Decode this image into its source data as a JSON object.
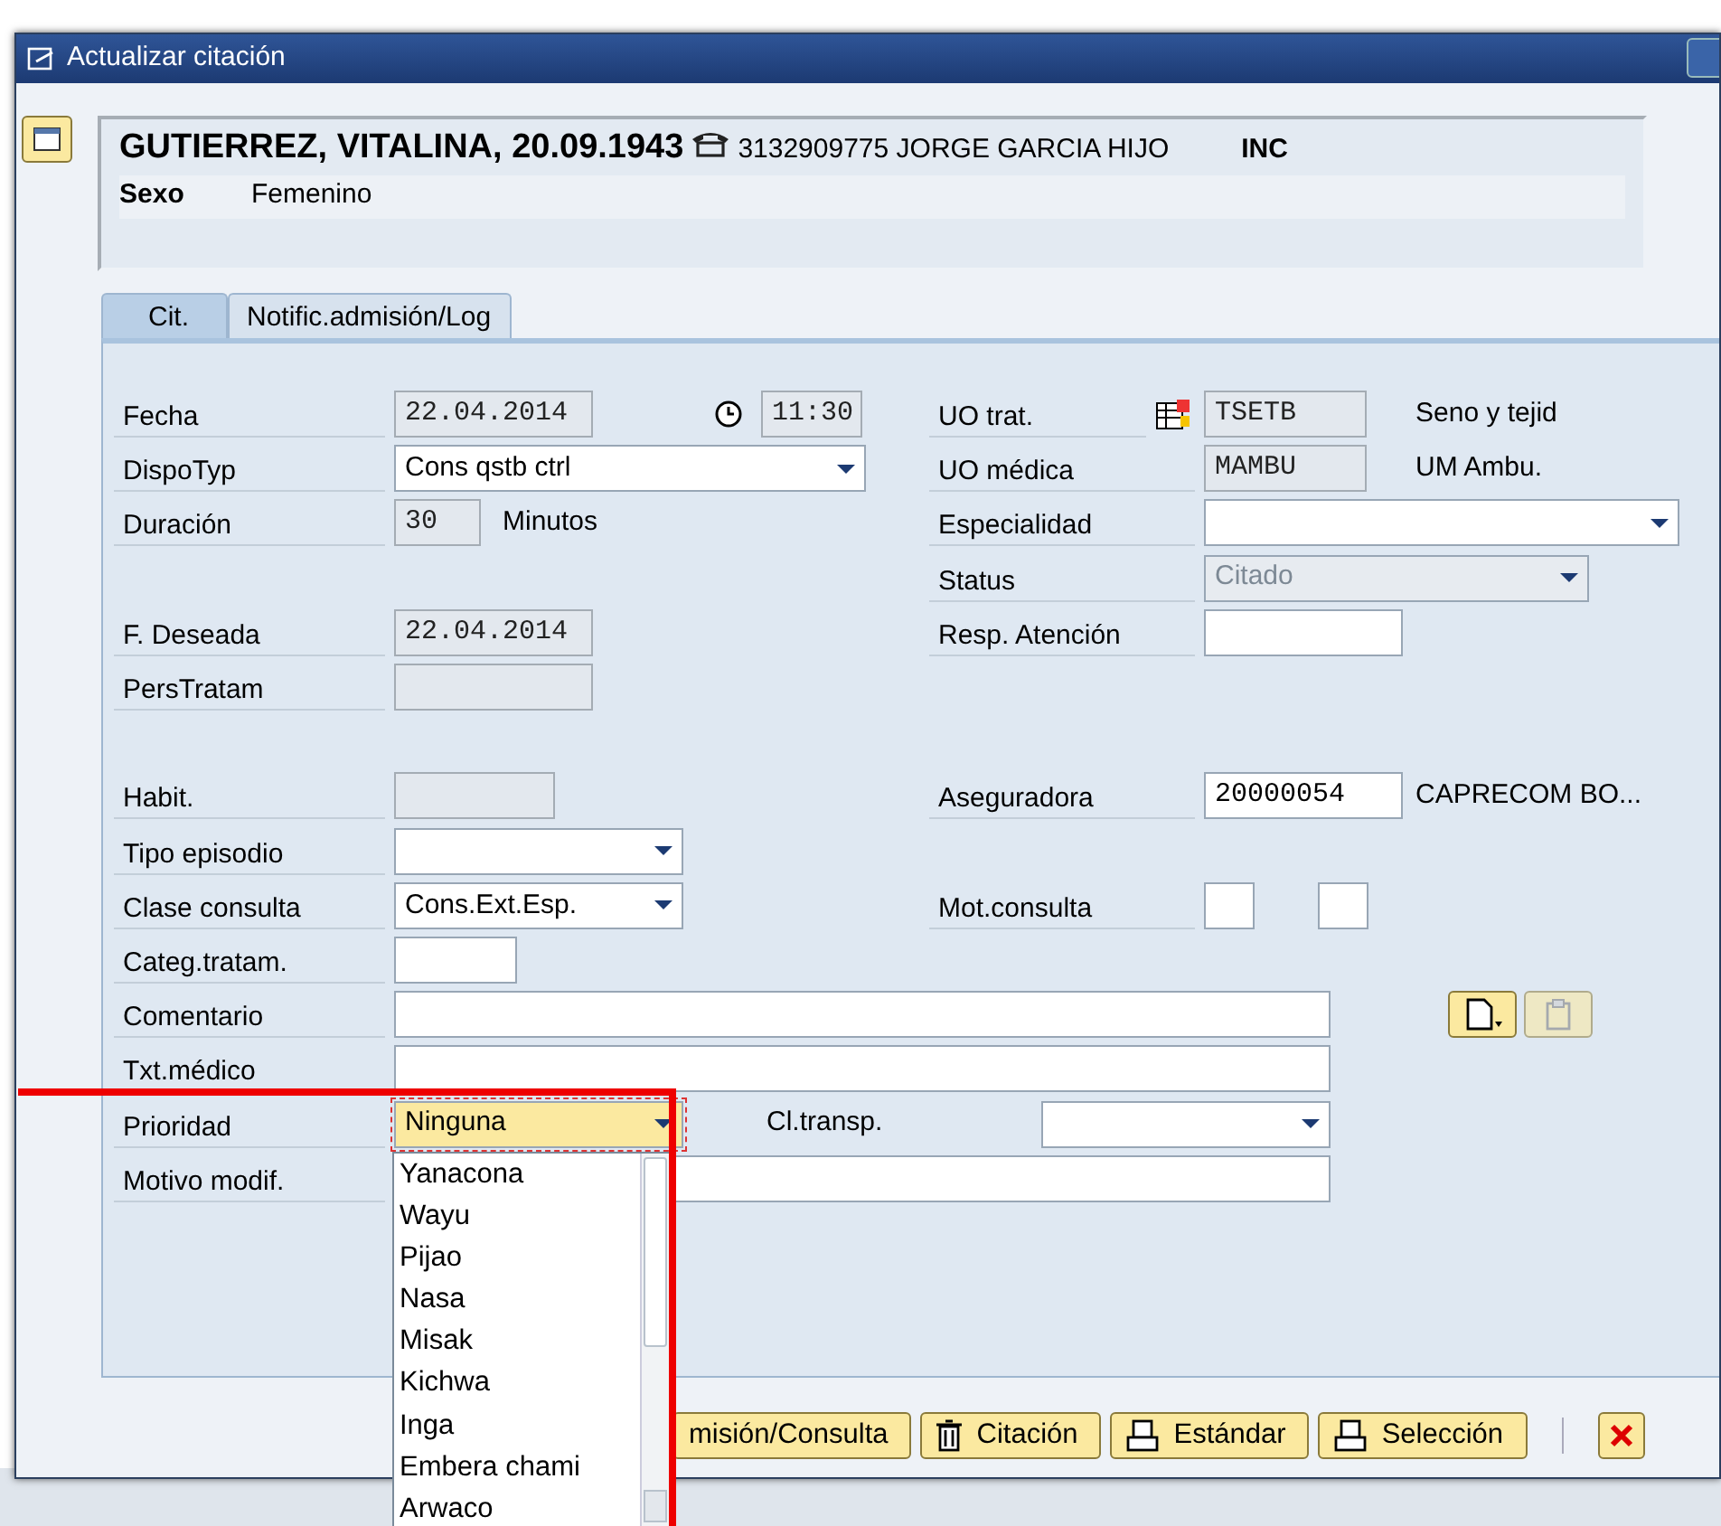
{
  "window": {
    "title": "Actualizar citación"
  },
  "header": {
    "patient": "GUTIERREZ, VITALINA, 20.09.1943",
    "phone": "3132909775 JORGE GARCIA HIJO",
    "flag": "INC",
    "sex_label": "Sexo",
    "sex_value": "Femenino"
  },
  "tabs": [
    {
      "label": "Cit.",
      "selected": true
    },
    {
      "label": "Notific.admisión/Log",
      "selected": false
    }
  ],
  "left_fields": [
    {
      "label": "Fecha",
      "kind": "readonly",
      "value": "22.04.2014",
      "time": "11:30"
    },
    {
      "label": "DispoTyp",
      "kind": "select",
      "value": "Cons qstb ctrl"
    },
    {
      "label": "Duración",
      "kind": "readonly",
      "value": "30",
      "unit": "Minutos"
    },
    {
      "label": "F. Deseada",
      "kind": "readonly",
      "value": "22.04.2014"
    },
    {
      "label": "PersTratam",
      "kind": "readonly"
    },
    {
      "label": "Habit.",
      "kind": "readonly"
    },
    {
      "label": "Tipo episodio",
      "kind": "select"
    },
    {
      "label": "Clase consulta",
      "kind": "select",
      "value": "Cons.Ext.Esp."
    },
    {
      "label": "Categ.tratam.",
      "kind": "input"
    },
    {
      "label": "Comentario",
      "kind": "input"
    },
    {
      "label": "Txt.médico",
      "kind": "input"
    },
    {
      "label": "Prioridad",
      "kind": "select",
      "value": "Ninguna",
      "focused": true,
      "extra_label": "Cl.transp."
    },
    {
      "label": "Motivo modif.",
      "kind": "input"
    }
  ],
  "right_fields": [
    {
      "label": "UO trat.",
      "kind": "readonly",
      "value": "TSETB",
      "note": "Seno y tejid"
    },
    {
      "label": "UO médica",
      "kind": "readonly",
      "value": "MAMBU",
      "note": "UM Ambu."
    },
    {
      "label": "Especialidad",
      "kind": "select",
      "disabled": false
    },
    {
      "label": "Status",
      "kind": "select",
      "value": "Citado",
      "disabled": true
    },
    {
      "label": "Resp. Atención",
      "kind": "input"
    },
    {
      "label": "Aseguradora",
      "kind": "input",
      "value": "20000054",
      "note": "CAPRECOM BO..."
    },
    {
      "label": "Mot.consulta",
      "kind": "pair"
    }
  ],
  "comment_buttons": [
    {
      "disabled": false
    },
    {
      "disabled": true
    }
  ],
  "dropdown": {
    "items": [
      "Yanacona",
      "Wayu",
      "Pijao",
      "Nasa",
      "Misak",
      "Kichwa",
      "Inga",
      "Embera chami",
      "Arwaco"
    ]
  },
  "toolbar": [
    {
      "label": "misión/Consulta",
      "kind": "plain"
    },
    {
      "label": "Citación",
      "kind": "trash"
    },
    {
      "label": "Estándar",
      "kind": "print"
    },
    {
      "label": "Selección",
      "kind": "print"
    },
    {
      "kind": "close"
    }
  ]
}
